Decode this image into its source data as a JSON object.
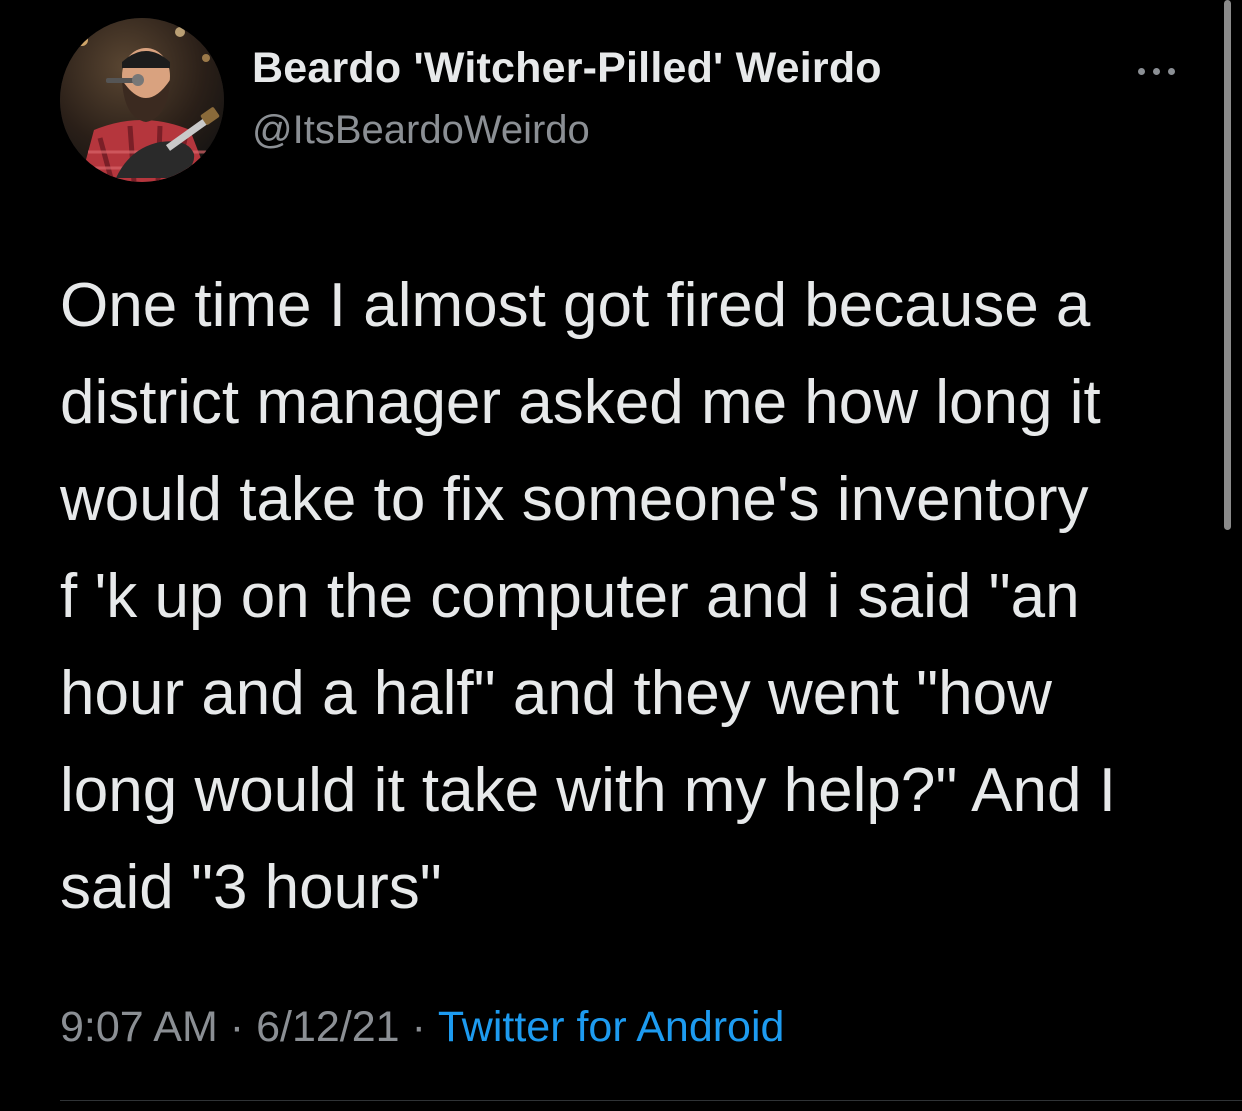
{
  "author": {
    "display_name": "Beardo 'Witcher-Pilled' Weirdo",
    "handle": "@ItsBeardoWeirdo",
    "avatar_icon": "profile-photo"
  },
  "tweet": {
    "text": "One time I almost got fired because a\ndistrict manager asked me how long it\nwould take to fix someone's inventory\nf   'k up on the computer and i said \"an\nhour and a half\" and they went \"how\nlong would it take with my help?\" And I\nsaid \"3 hours\"",
    "time": "9:07 AM",
    "date": "6/12/21",
    "separator": "·",
    "source": "Twitter for Android"
  },
  "icons": {
    "more": "more-options-icon"
  },
  "colors": {
    "background": "#000000",
    "text": "#e7e9ea",
    "secondary": "#8b8f94",
    "link": "#1d9bf0"
  }
}
